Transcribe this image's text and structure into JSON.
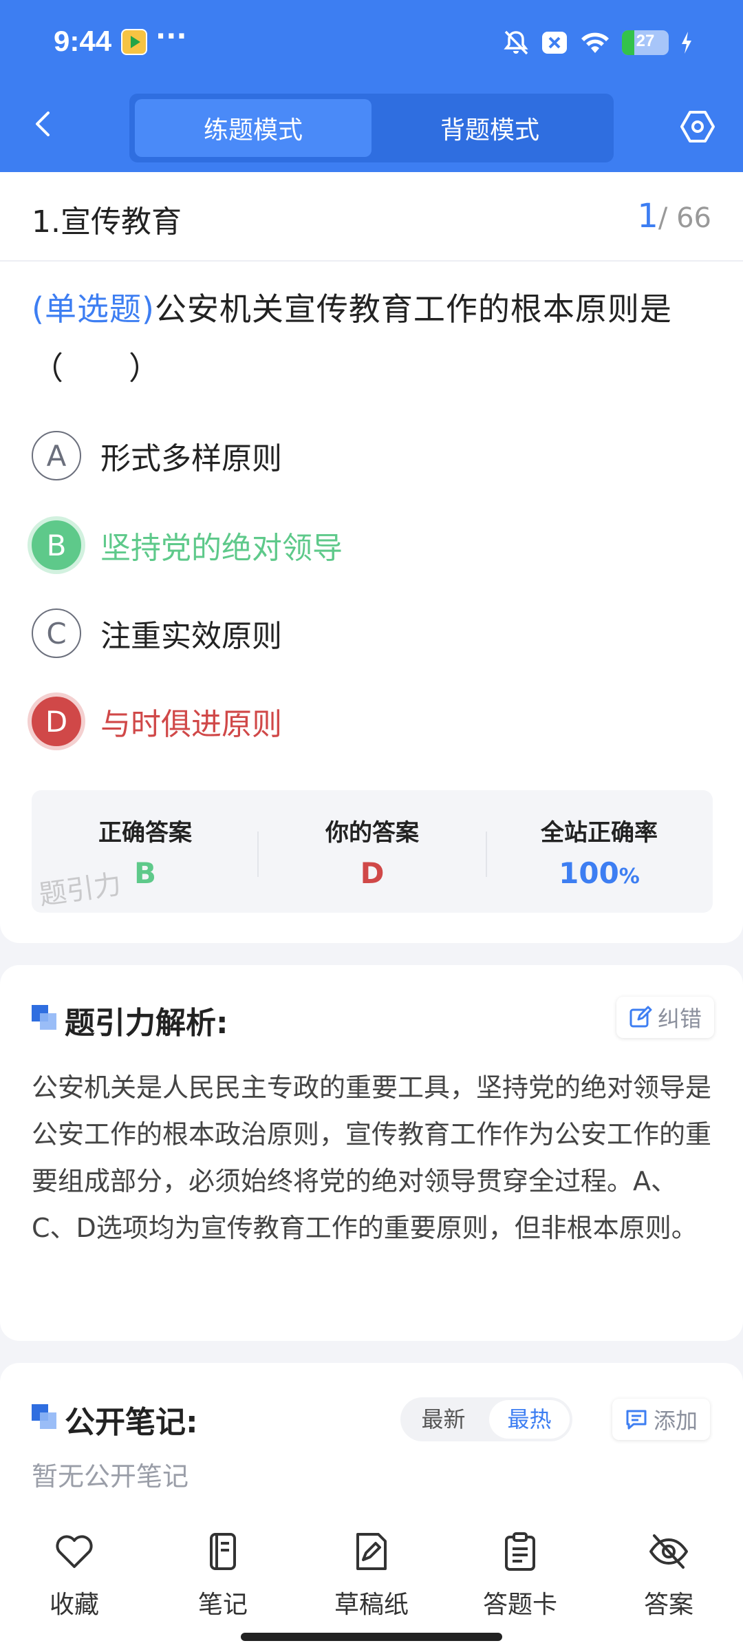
{
  "status_bar": {
    "time": "9:44",
    "more": "···",
    "battery": "27",
    "battery_level": 0.27
  },
  "header": {
    "modes": [
      "练题模式",
      "背题模式"
    ],
    "active_mode": "练题模式"
  },
  "question": {
    "section": "1.宣传教育",
    "current": "1",
    "total": "/ 66",
    "type_tag": "(单选题)",
    "text": "公安机关宣传教育工作的根本原则是（　　）",
    "options": [
      {
        "letter": "A",
        "text": "形式多样原则",
        "state": "normal"
      },
      {
        "letter": "B",
        "text": "坚持党的绝对领导",
        "state": "correct"
      },
      {
        "letter": "C",
        "text": "注重实效原则",
        "state": "normal"
      },
      {
        "letter": "D",
        "text": "与时俱进原则",
        "state": "wrong"
      }
    ]
  },
  "summary": {
    "correct_label": "正确答案",
    "correct_value": "B",
    "yours_label": "你的答案",
    "yours_value": "D",
    "rate_label": "全站正确率",
    "rate_value": "100",
    "rate_unit": "%",
    "watermark": "题引力"
  },
  "analysis": {
    "title": "题引力解析:",
    "report_label": "纠错",
    "body": "公安机关是人民民主专政的重要工具，坚持党的绝对领导是公安工作的根本政治原则，宣传教育工作作为公安工作的重要组成部分，必须始终将党的绝对领导贯穿全过程。A、C、D选项均为宣传教育工作的重要原则，但非根本原则。"
  },
  "notes": {
    "title": "公开笔记:",
    "sort_options": [
      "最新",
      "最热"
    ],
    "active_sort": "最热",
    "add_label": "添加",
    "empty_text": "暂无公开笔记"
  },
  "toolbar": {
    "items": [
      {
        "label": "收藏",
        "icon": "heart-icon"
      },
      {
        "label": "笔记",
        "icon": "notebook-icon"
      },
      {
        "label": "草稿纸",
        "icon": "draft-icon"
      },
      {
        "label": "答题卡",
        "icon": "clipboard-icon"
      },
      {
        "label": "答案",
        "icon": "eye-off-icon"
      }
    ]
  },
  "colors": {
    "primary": "#3d7ef2",
    "correct": "#5ec98a",
    "wrong": "#d04848"
  }
}
